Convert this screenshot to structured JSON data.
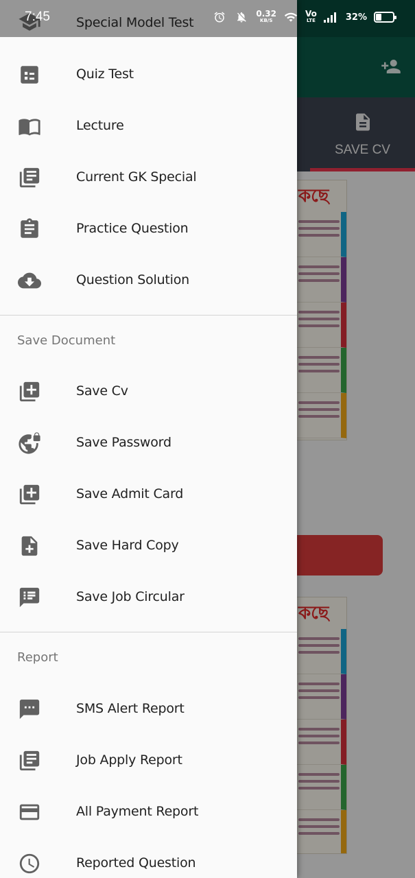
{
  "status_bar": {
    "time": "7:45",
    "net_speed_value": "0.32",
    "net_speed_unit": "KB/S",
    "volte_top": "Vo",
    "volte_bottom": "LTE",
    "battery_percent_label": "32%",
    "battery_level": 0.32,
    "icons": [
      "alarm-icon",
      "bell-off-icon",
      "wifi-icon",
      "signal-icon",
      "battery-icon"
    ]
  },
  "background": {
    "tab_label": "SAVE CV",
    "promo_heading": "কছে",
    "header_color": "#0a5a48",
    "tabbar_color": "#3d4350",
    "tab_indicator_color": "#e8354d",
    "banner_color": "#d93a3a"
  },
  "drawer": {
    "top_item": {
      "label": "Special Model Test",
      "icon": "school-icon"
    },
    "items": [
      {
        "label": "Quiz Test",
        "icon": "dashboard-icon"
      },
      {
        "label": "Lecture",
        "icon": "book-open-icon"
      },
      {
        "label": "Current GK Special",
        "icon": "library-books-icon"
      },
      {
        "label": "Practice Question",
        "icon": "assignment-icon"
      },
      {
        "label": "Question Solution",
        "icon": "cloud-download-icon"
      }
    ],
    "sections": [
      {
        "title": "Save Document",
        "items": [
          {
            "label": "Save Cv",
            "icon": "library-add-icon"
          },
          {
            "label": "Save Password",
            "icon": "vpn-lock-icon"
          },
          {
            "label": "Save Admit Card",
            "icon": "library-add-icon"
          },
          {
            "label": "Save Hard Copy",
            "icon": "note-add-icon"
          },
          {
            "label": "Save Job Circular",
            "icon": "feedback-list-icon"
          }
        ]
      },
      {
        "title": "Report",
        "items": [
          {
            "label": "SMS Alert Report",
            "icon": "sms-icon"
          },
          {
            "label": "Job Apply Report",
            "icon": "library-books-icon"
          },
          {
            "label": "All Payment Report",
            "icon": "credit-card-icon"
          },
          {
            "label": "Reported Question",
            "icon": "clock-icon"
          }
        ]
      }
    ]
  }
}
